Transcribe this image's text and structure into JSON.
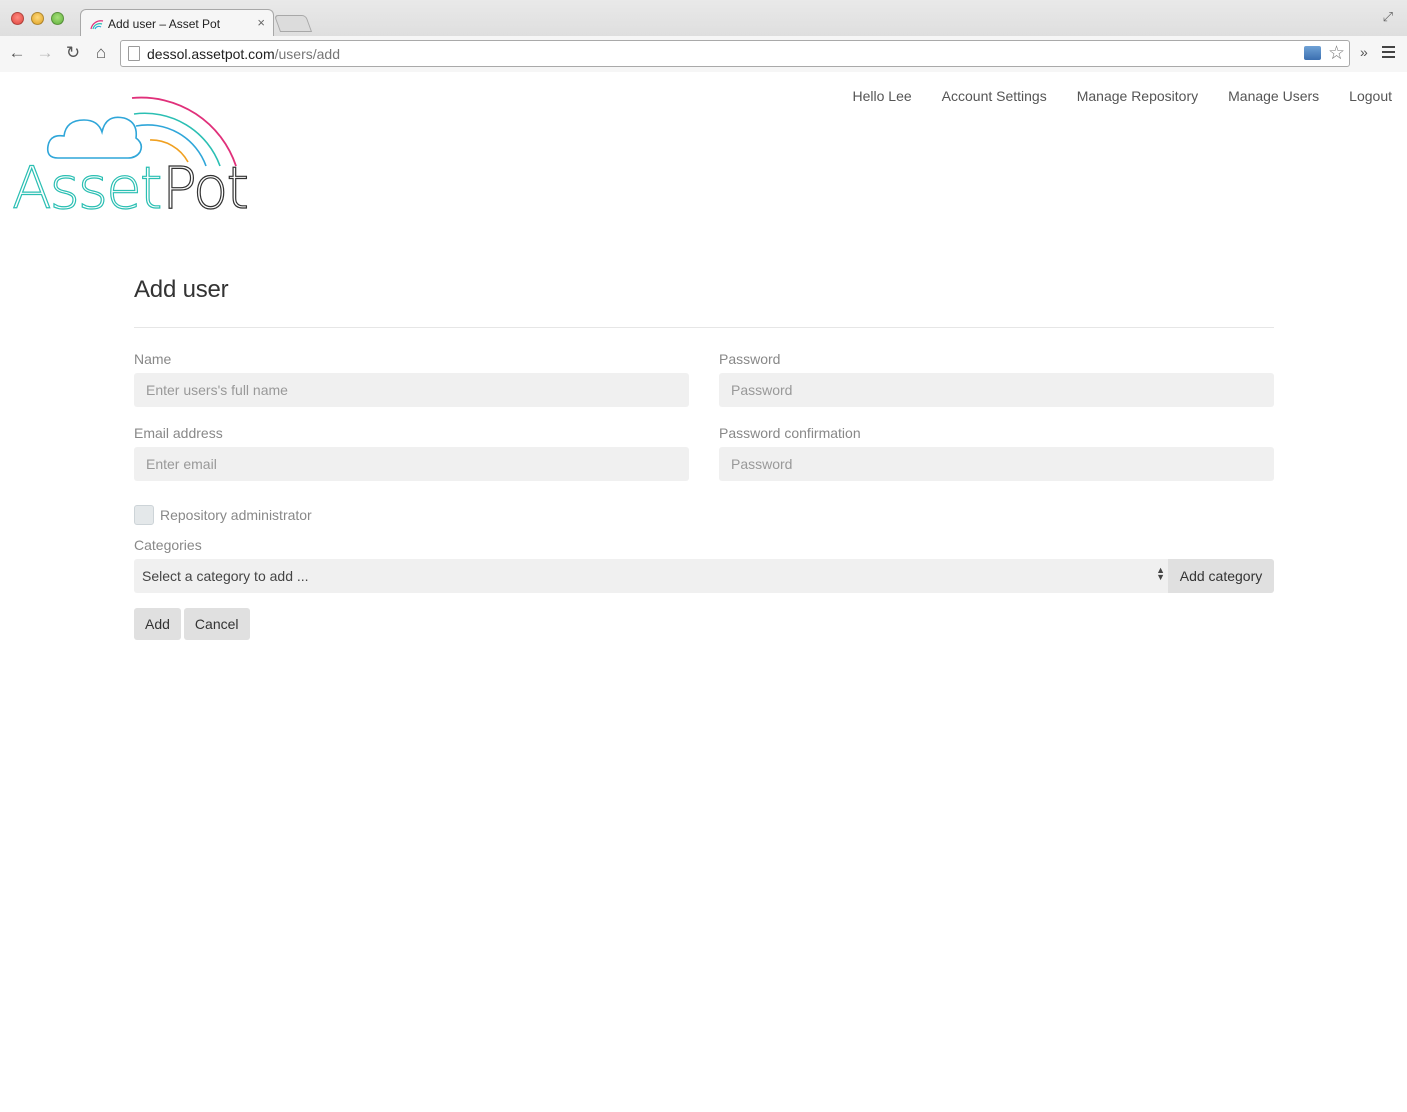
{
  "browser": {
    "tab_title": "Add user – Asset Pot",
    "tab_close": "×",
    "url_domain": "dessol.assetpot.com",
    "url_path": "/users/add"
  },
  "nav": {
    "greeting": "Hello Lee",
    "account_settings": "Account Settings",
    "manage_repository": "Manage Repository",
    "manage_users": "Manage Users",
    "logout": "Logout"
  },
  "logo": {
    "text_asset": "Asset",
    "text_pot": "Pot",
    "colors": {
      "cloud": "#2fa6d9",
      "arc_pink": "#e0307a",
      "arc_teal": "#2bbfb3",
      "arc_orange": "#f0a020",
      "text_teal": "#2bbfb3",
      "text_dark": "#333333"
    }
  },
  "form": {
    "title": "Add user",
    "name_label": "Name",
    "name_placeholder": "Enter users's full name",
    "password_label": "Password",
    "password_placeholder": "Password",
    "email_label": "Email address",
    "email_placeholder": "Enter email",
    "password_confirmation_label": "Password confirmation",
    "password_confirmation_placeholder": "Password",
    "repo_admin_label": "Repository administrator",
    "categories_label": "Categories",
    "category_select_value": "Select a category to add ...",
    "add_category_label": "Add category",
    "add_label": "Add",
    "cancel_label": "Cancel"
  }
}
